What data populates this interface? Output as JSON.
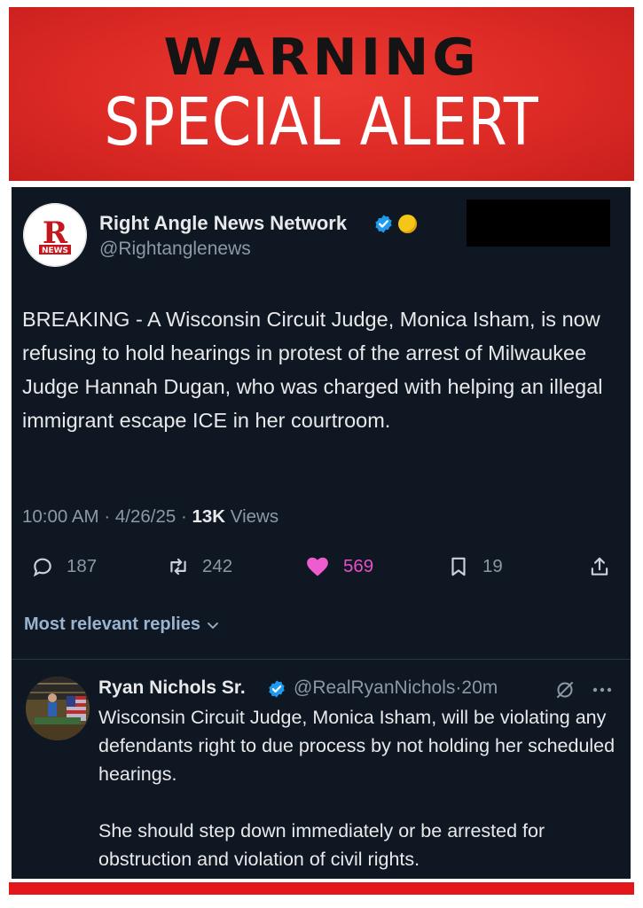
{
  "banner": {
    "warning": "WARNING",
    "alert": "SPECIAL ALERT"
  },
  "tweet": {
    "author_name": "Right Angle News Network",
    "handle": "@Rightanglenews",
    "avatar_text": "NEWS",
    "avatar_letter": "R",
    "text": "BREAKING - A Wisconsin Circuit Judge, Monica Isham, is now refusing to hold hearings in protest of the arrest of Milwaukee Judge Hannah Dugan, who was charged with helping an illegal immigrant escape ICE in her courtroom.",
    "time": "10:00 AM",
    "date": "4/26/25",
    "views_count": "13K",
    "views_label": "Views",
    "actions": {
      "replies": "187",
      "reposts": "242",
      "likes": "569",
      "bookmarks": "19"
    },
    "colors": {
      "background": "#0f1722",
      "verified": "#1d9bf0",
      "like": "#f91880",
      "gold_badge": "#f5c518"
    }
  },
  "replies_filter": {
    "label": "Most relevant replies"
  },
  "reply": {
    "name": "Ryan Nichols Sr.",
    "handle": "@RealRyanNichols",
    "time": "20m",
    "text": "Wisconsin Circuit Judge, Monica Isham, will be violating any defendants right to due process by not holding her scheduled hearings.\n\nShe should step down immediately or be arrested for obstruction and violation of civil rights."
  },
  "icons": [
    "verified-icon",
    "gold-badge-icon",
    "reply-icon",
    "repost-icon",
    "like-icon",
    "bookmark-icon",
    "share-icon",
    "chevron-down-icon",
    "grok-icon",
    "more-icon"
  ]
}
